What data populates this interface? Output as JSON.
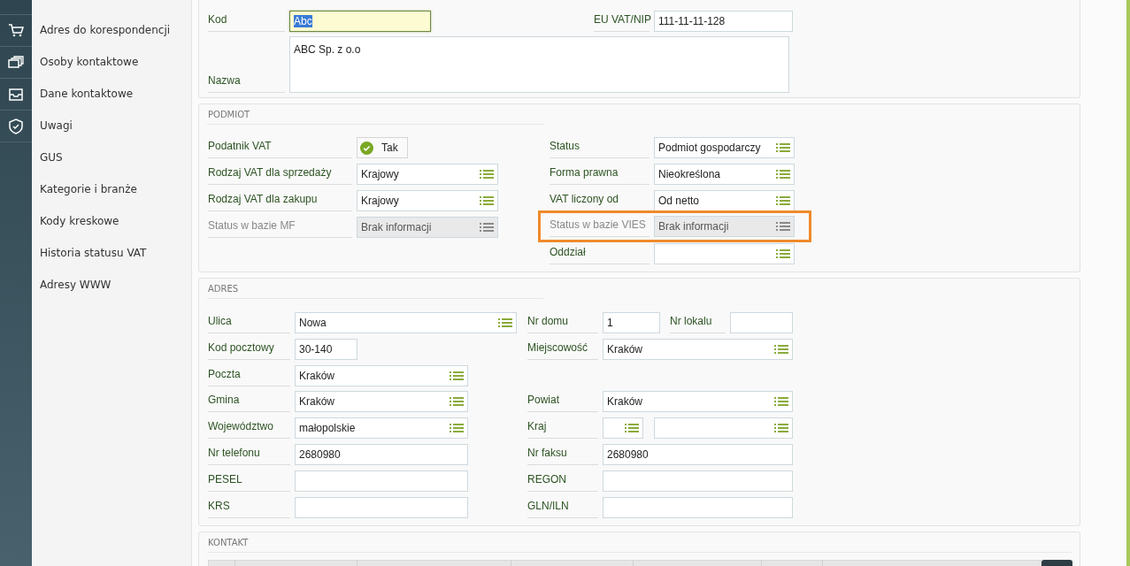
{
  "sidebar": {
    "rail": [
      {
        "kind": "cart"
      },
      {
        "kind": "cards"
      },
      {
        "kind": "tray"
      },
      {
        "kind": "shield"
      }
    ],
    "items": [
      {
        "label": "Adres do korespondencji"
      },
      {
        "label": "Osoby kontaktowe"
      },
      {
        "label": "Dane kontaktowe"
      },
      {
        "label": "Uwagi"
      },
      {
        "label": "GUS"
      },
      {
        "label": "Kategorie i branże"
      },
      {
        "label": "Kody kreskowe"
      },
      {
        "label": "Historia statusu VAT"
      },
      {
        "label": "Adresy WWW"
      }
    ]
  },
  "sections": [
    {
      "rows": [
        {
          "left": [
            {
              "label": "Kod",
              "kind": "text",
              "value": "Abc",
              "focused": true,
              "text_selected": true
            }
          ],
          "right": [
            {
              "label": "EU VAT/NIP",
              "kind": "text",
              "value": "111-11-11-128"
            }
          ]
        },
        {
          "left": [
            {
              "label": "Nazwa",
              "kind": "textarea",
              "value": "ABC Sp. z o.o"
            }
          ]
        }
      ]
    },
    {
      "title": "PODMIOT",
      "rows": [
        {
          "left": [
            {
              "label": "Podatnik VAT",
              "kind": "check",
              "value": "Tak",
              "checked": true
            }
          ],
          "right": [
            {
              "label": "Status",
              "kind": "select",
              "value": "Podmiot gospodarczy"
            }
          ]
        },
        {
          "left": [
            {
              "label": "Rodzaj VAT dla sprzedaży",
              "kind": "select",
              "value": "Krajowy"
            }
          ],
          "right": [
            {
              "label": "Forma prawna",
              "kind": "select",
              "value": "Nieokreślona"
            }
          ]
        },
        {
          "left": [
            {
              "label": "Rodzaj VAT dla zakupu",
              "kind": "select",
              "value": "Krajowy"
            }
          ],
          "right": [
            {
              "label": "VAT liczony od",
              "kind": "select",
              "value": "Od netto"
            }
          ]
        },
        {
          "left": [
            {
              "label": "Status w bazie MF",
              "kind": "select",
              "value": "Brak informacji",
              "disabled": true
            }
          ],
          "right": [
            {
              "label": "Status w bazie VIES",
              "kind": "select",
              "value": "Brak informacji",
              "disabled": true,
              "highlighted": true
            }
          ]
        },
        {
          "right": [
            {
              "label": "Oddział",
              "kind": "select"
            }
          ]
        }
      ]
    },
    {
      "title": "ADRES",
      "rows": [
        {
          "left": [
            {
              "label": "Ulica",
              "kind": "select",
              "value": "Nowa"
            }
          ],
          "right": [
            {
              "label": "Nr domu",
              "kind": "text",
              "value": "1"
            },
            {
              "label": "Nr lokalu",
              "kind": "text"
            }
          ]
        },
        {
          "left": [
            {
              "label": "Kod pocztowy",
              "kind": "text",
              "value": "30-140"
            }
          ],
          "right": [
            {
              "label": "Miejscowość",
              "kind": "select",
              "value": "Kraków"
            }
          ]
        },
        {
          "left": [
            {
              "label": "Poczta",
              "kind": "select",
              "value": "Kraków"
            }
          ]
        },
        {
          "left": [
            {
              "label": "Gmina",
              "kind": "select",
              "value": "Kraków"
            }
          ],
          "right": [
            {
              "label": "Powiat",
              "kind": "select",
              "value": "Kraków"
            }
          ]
        },
        {
          "left": [
            {
              "label": "Województwo",
              "kind": "select",
              "value": "małopolskie"
            }
          ],
          "right": [
            {
              "label": "Kraj",
              "kind": "select"
            },
            {
              "kind": "select"
            }
          ]
        },
        {
          "left": [
            {
              "label": "Nr telefonu",
              "kind": "text",
              "value": "2680980"
            }
          ],
          "right": [
            {
              "label": "Nr faksu",
              "kind": "text",
              "value": "2680980"
            }
          ]
        },
        {
          "left": [
            {
              "label": "PESEL",
              "kind": "text"
            }
          ],
          "right": [
            {
              "label": "REGON",
              "kind": "text"
            }
          ]
        },
        {
          "left": [
            {
              "label": "KRS",
              "kind": "text"
            }
          ],
          "right": [
            {
              "label": "GLN/ILN",
              "kind": "text"
            }
          ]
        }
      ]
    },
    {
      "title": "KONTAKT",
      "kind": "table"
    }
  ]
}
